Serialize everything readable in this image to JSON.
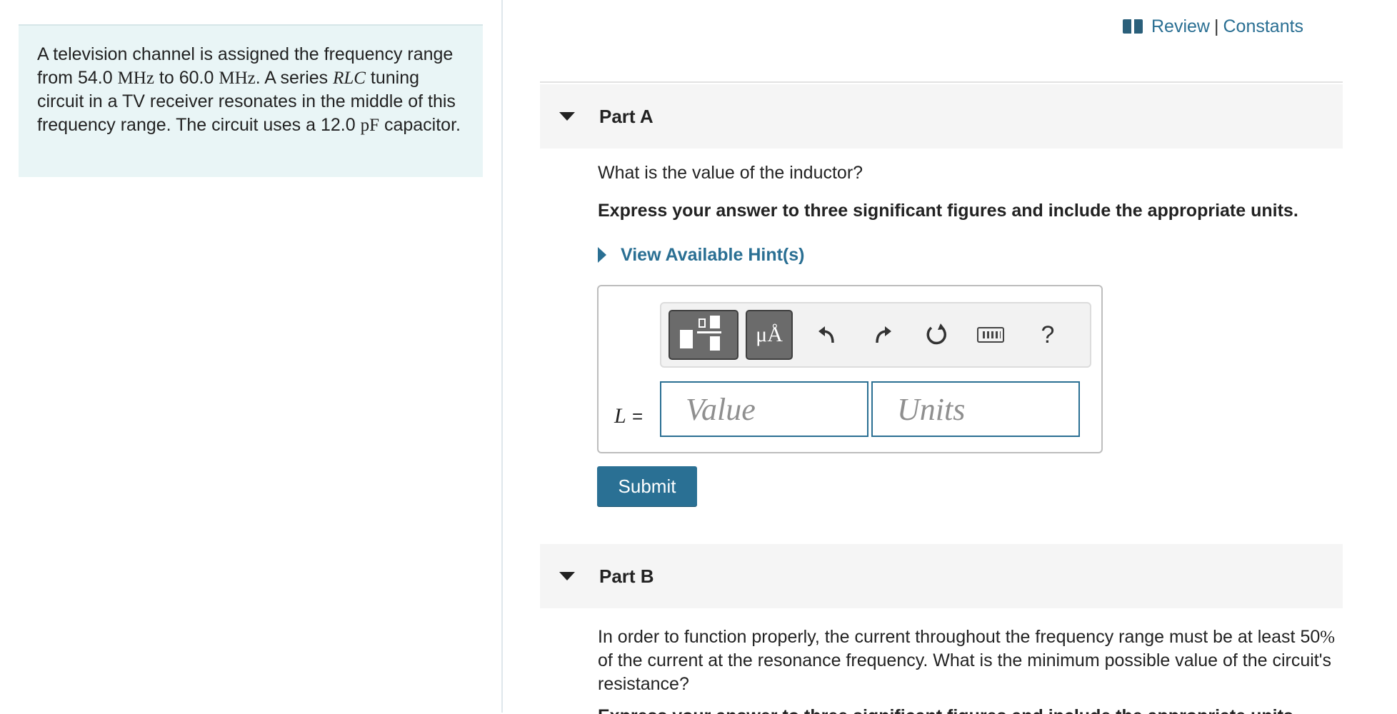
{
  "problem": {
    "s1": "A television channel is assigned the frequency range from ",
    "f_low": "54.0",
    "f_unit": "MHz",
    "s2": " to ",
    "f_high": "60.0",
    "s3": ". A series ",
    "circuit": "RLC",
    "s4": " tuning circuit in a TV receiver resonates in the middle of this frequency range. The circuit uses a ",
    "cap_value": "12.0",
    "cap_unit": "pF",
    "s5": " capacitor."
  },
  "header": {
    "review": "Review",
    "separator": "|",
    "constants": "Constants"
  },
  "part_a": {
    "title": "Part A",
    "question": "What is the value of the inductor?",
    "instruction": "Express your answer to three significant figures and include the appropriate units.",
    "hint": "View Available Hint(s)",
    "toolbar": {
      "units_symbol": "μÅ",
      "help": "?"
    },
    "variable": "L",
    "equals": "=",
    "value_placeholder": "Value",
    "units_placeholder": "Units",
    "submit": "Submit"
  },
  "part_b": {
    "title": "Part B",
    "q1": "In order to function properly, the current throughout the frequency range must be at least ",
    "percent_value": "50",
    "percent_sign": "%",
    "q2": " of the current at the resonance frequency. What is the minimum possible value of the circuit's resistance?",
    "instruction": "Express your answer to three significant figures and include the appropriate units."
  }
}
